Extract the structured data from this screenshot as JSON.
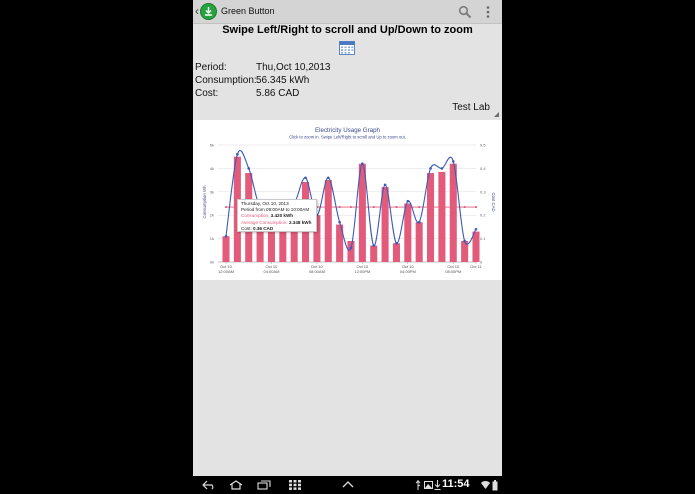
{
  "app": {
    "title": "Green Button",
    "instruction": "Swipe Left/Right to scroll and Up/Down to zoom"
  },
  "summary": {
    "period_label": "Period:",
    "period_value": "Thu,Oct 10,2013",
    "consumption_label": "Consumption:",
    "consumption_value": "56.345 kWh",
    "cost_label": "Cost:",
    "cost_value": "5.86 CAD"
  },
  "location_selector": {
    "selected": "Test Lab"
  },
  "chart_data": {
    "type": "bar",
    "title": "Electricity Usage Graph",
    "subtitle": "Click to zoom in. Swipe Left/Right to scroll and Up to zoom out.",
    "ylabel": "Consumption Wh",
    "y2label": "Cost CAD",
    "ylim": [
      0,
      5000
    ],
    "y2lim": [
      0,
      0.5
    ],
    "yticks": [
      "0k",
      "1k",
      "2k",
      "3k",
      "4k",
      "5k"
    ],
    "y2ticks": [
      "0",
      "0.1",
      "0.2",
      "0.3",
      "0.4",
      "0.5"
    ],
    "xtick_labels": [
      [
        "Oct 10",
        "12:00AM"
      ],
      [
        "Oct 10",
        "04:00AM"
      ],
      [
        "Oct 10",
        "08:00AM"
      ],
      [
        "Oct 10",
        "12:00PM"
      ],
      [
        "Oct 10",
        "04:00PM"
      ],
      [
        "Oct 10",
        "08:00PM"
      ],
      [
        "Oct 11",
        ""
      ]
    ],
    "grid": true,
    "series": [
      {
        "name": "Consumption",
        "type": "bar",
        "color": "#e35b7a",
        "values": [
          1100,
          4500,
          3800,
          2200,
          2100,
          2300,
          2400,
          3420,
          2000,
          3500,
          1600,
          900,
          4200,
          700,
          3200,
          800,
          2500,
          1700,
          3800,
          3850,
          4200,
          900,
          1300
        ]
      },
      {
        "name": "Cost",
        "type": "line",
        "color": "#3d59b8",
        "values": [
          0.11,
          0.46,
          0.4,
          0.23,
          0.22,
          0.24,
          0.25,
          0.36,
          0.2,
          0.36,
          0.17,
          0.06,
          0.42,
          0.07,
          0.33,
          0.08,
          0.26,
          0.17,
          0.4,
          0.4,
          0.43,
          0.09,
          0.14
        ]
      },
      {
        "name": "Average Consumption",
        "type": "line",
        "color": "#e35b7a",
        "values": [
          2348,
          2348,
          2348,
          2348,
          2348,
          2348,
          2348,
          2348,
          2348,
          2348,
          2348,
          2348,
          2348,
          2348,
          2348,
          2348,
          2348,
          2348,
          2348,
          2348,
          2348,
          2348,
          2348
        ]
      }
    ],
    "tooltip": {
      "date": "Thursday, Oct 10, 2013",
      "period": "Period from 09:00AM to 10:00AM",
      "consumption_label": "Consumption:",
      "consumption_value": "3.420 kWh",
      "average_label": "Average Consumption:",
      "average_value": "2.348 kWh",
      "cost_label": "Cost:",
      "cost_value": "0.36 CAD"
    }
  },
  "status_bar": {
    "time": "11:54"
  },
  "icons": {
    "back": "back-arrow-icon",
    "home": "home-icon",
    "recents": "recent-apps-icon",
    "apps": "apps-grid-icon",
    "up": "chevron-up-icon",
    "usb": "usb-icon",
    "gallery": "gallery-icon",
    "download": "download-icon",
    "wifi": "wifi-icon",
    "battery": "battery-icon",
    "search": "search-icon",
    "overflow": "overflow-menu-icon",
    "calendar": "calendar-icon"
  }
}
